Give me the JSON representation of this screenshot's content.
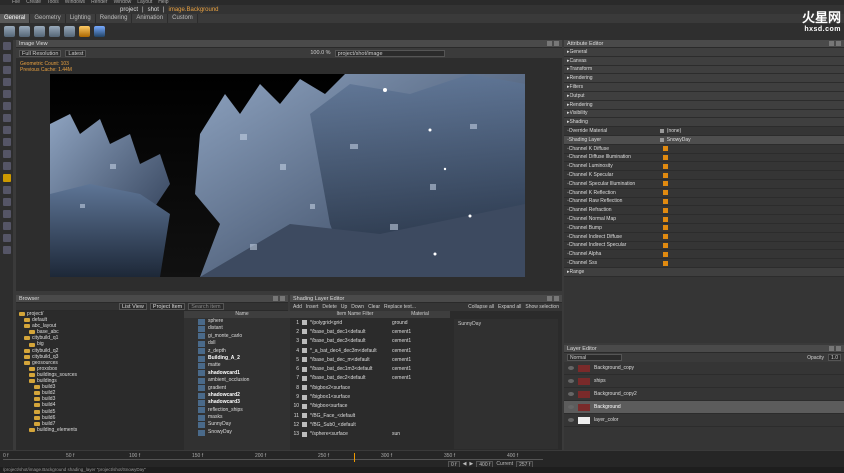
{
  "menubar": [
    "File",
    "Create",
    "Tools",
    "Windows",
    "Render",
    "Window",
    "Layout",
    "Help"
  ],
  "crumbs": {
    "project": "project",
    "shot": "shot",
    "item": "image.Background"
  },
  "ribbon_tabs": [
    "General",
    "Geometry",
    "Lighting",
    "Rendering",
    "Animation",
    "Custom"
  ],
  "viewer": {
    "title": "Image View",
    "resolution": "Full Resolution",
    "version": "Latest",
    "zoom": "100.0 %",
    "path": "project/shot/image",
    "stats_line1": "Geometric Count: 103",
    "stats_line2": "Previous Cache: 1.44M"
  },
  "browser": {
    "title": "Browser",
    "view_mode": "List View",
    "filter": "Project Item",
    "search_placeholder": "Search item",
    "column": "Name",
    "tree": [
      {
        "label": "project/",
        "depth": 0
      },
      {
        "label": "default",
        "depth": 1
      },
      {
        "label": "abc_layout",
        "depth": 1
      },
      {
        "label": "base_abc",
        "depth": 2
      },
      {
        "label": "citybuild_q1",
        "depth": 1
      },
      {
        "label": "big",
        "depth": 2
      },
      {
        "label": "citybuild_q2",
        "depth": 1
      },
      {
        "label": "citybuild_q3",
        "depth": 1
      },
      {
        "label": "geosources",
        "depth": 1
      },
      {
        "label": "proxxbox",
        "depth": 2
      },
      {
        "label": "buildings_sources",
        "depth": 2
      },
      {
        "label": "buildings",
        "depth": 2
      },
      {
        "label": "build3",
        "depth": 3
      },
      {
        "label": "build2",
        "depth": 3
      },
      {
        "label": "build3",
        "depth": 3
      },
      {
        "label": "build4",
        "depth": 3
      },
      {
        "label": "build5",
        "depth": 3
      },
      {
        "label": "build6",
        "depth": 3
      },
      {
        "label": "build7",
        "depth": 3
      },
      {
        "label": "building_elements",
        "depth": 2
      }
    ],
    "items": [
      {
        "label": "sphere",
        "bold": false
      },
      {
        "label": "distant",
        "bold": false
      },
      {
        "label": "gi_monte_carlo",
        "bold": false
      },
      {
        "label": "dsll",
        "bold": false
      },
      {
        "label": "z_depth",
        "bold": false
      },
      {
        "label": "Building_A_2",
        "bold": true
      },
      {
        "label": "matte",
        "bold": false
      },
      {
        "label": "shadowcard1",
        "bold": true
      },
      {
        "label": "ambient_occlusion",
        "bold": false
      },
      {
        "label": "gradient",
        "bold": false
      },
      {
        "label": "shadowcard2",
        "bold": true
      },
      {
        "label": "shadowcard3",
        "bold": true
      },
      {
        "label": "reflection_ships",
        "bold": false
      },
      {
        "label": "masks",
        "bold": false
      },
      {
        "label": "SunnyDay",
        "bold": false
      },
      {
        "label": "SnowyDay",
        "bold": false
      }
    ]
  },
  "shading": {
    "title": "Shading Layer Editor",
    "toolbar": [
      "Add",
      "Insert",
      "Delete",
      "Up",
      "Down",
      "Clear",
      "Replace text..."
    ],
    "actions": [
      "Collapse all",
      "Expand all",
      "Show selection"
    ],
    "col_filter": "Item Name Filter",
    "col_material": "Material",
    "rows": [
      {
        "n": "1",
        "filter": "*/polygrid<grid",
        "material": "ground"
      },
      {
        "n": "2",
        "filter": "*/base_bat_dec1<default",
        "material": "cement1"
      },
      {
        "n": "3",
        "filter": "*/base_bat_dec3<default",
        "material": "cement1"
      },
      {
        "n": "4",
        "filter": "*_a_bat_dec4_dec3m<default",
        "material": "cement1"
      },
      {
        "n": "5",
        "filter": "*/base_bat_dec_m<default",
        "material": "cement1"
      },
      {
        "n": "6",
        "filter": "*/base_bat_dec1m3<default",
        "material": "cement1"
      },
      {
        "n": "7",
        "filter": "*/base_bat_dec2<default",
        "material": "cement1"
      },
      {
        "n": "8",
        "filter": "*/bigbox2<surface",
        "material": ""
      },
      {
        "n": "9",
        "filter": "*/bigbox1<surface",
        "material": ""
      },
      {
        "n": "10",
        "filter": "*/bigbox<surface",
        "material": ""
      },
      {
        "n": "11",
        "filter": "*/BG_Face_<default",
        "material": ""
      },
      {
        "n": "12",
        "filter": "*/BG_Sub0_<default",
        "material": ""
      },
      {
        "n": "13",
        "filter": "*/sphere<surface",
        "material": "sun"
      }
    ],
    "layer_entry": "SunnyDay"
  },
  "attr": {
    "title": "Attribute Editor",
    "rows": [
      {
        "label": "General",
        "type": "section"
      },
      {
        "label": "Canvas",
        "type": "section"
      },
      {
        "label": "Transform",
        "type": "section"
      },
      {
        "label": "Rendering",
        "type": "section"
      },
      {
        "label": "Filters",
        "type": "section"
      },
      {
        "label": "Output",
        "type": "section"
      },
      {
        "label": "Rendering",
        "type": "section"
      },
      {
        "label": "Visibility",
        "type": "section"
      },
      {
        "label": "Shading",
        "type": "section"
      },
      {
        "label": "Override Material",
        "type": "value",
        "value": "(none)"
      },
      {
        "label": "Shading Layer",
        "type": "value",
        "value": "SnowyDay"
      },
      {
        "label": "Channel K Diffuse",
        "type": "check"
      },
      {
        "label": "Channel Diffuse Illumination",
        "type": "check"
      },
      {
        "label": "Channel Luminosity",
        "type": "check"
      },
      {
        "label": "Channel K Specular",
        "type": "check"
      },
      {
        "label": "Channel Specular Illumination",
        "type": "check"
      },
      {
        "label": "Channel K Reflection",
        "type": "check"
      },
      {
        "label": "Channel Raw Reflection",
        "type": "check"
      },
      {
        "label": "Channel Refraction",
        "type": "check"
      },
      {
        "label": "Channel Normal Map",
        "type": "check"
      },
      {
        "label": "Channel Bump",
        "type": "check"
      },
      {
        "label": "Channel Indirect Diffuse",
        "type": "check"
      },
      {
        "label": "Channel Indirect Specular",
        "type": "check"
      },
      {
        "label": "Channel Alpha",
        "type": "check"
      },
      {
        "label": "Channel Sss",
        "type": "check"
      },
      {
        "label": "Range",
        "type": "section"
      }
    ]
  },
  "layers": {
    "title": "Layer Editor",
    "blend": "Normal",
    "opacity_label": "Opacity",
    "opacity": "1.0",
    "rows": [
      {
        "label": "Background_copy",
        "thumb": "red",
        "selected": false
      },
      {
        "label": "ships",
        "thumb": "red",
        "selected": false
      },
      {
        "label": "Background_copy2",
        "thumb": "red",
        "selected": false
      },
      {
        "label": "Background",
        "thumb": "red",
        "selected": true
      },
      {
        "label": "layer_color",
        "thumb": "white",
        "selected": false
      }
    ]
  },
  "timeline": {
    "ticks": [
      "0 f",
      "50 f",
      "100 f",
      "150 f",
      "200 f",
      "250 f",
      "300 f",
      "350 f",
      "400 f"
    ],
    "start": "0 f",
    "end": "400 f",
    "current_label": "Current",
    "current": "257 f",
    "status": "/project/shot/image.Background shading_layer \"project/shot/SnowyDay\""
  },
  "logo": {
    "main": "火星网",
    "sub": "hxsd.com"
  }
}
